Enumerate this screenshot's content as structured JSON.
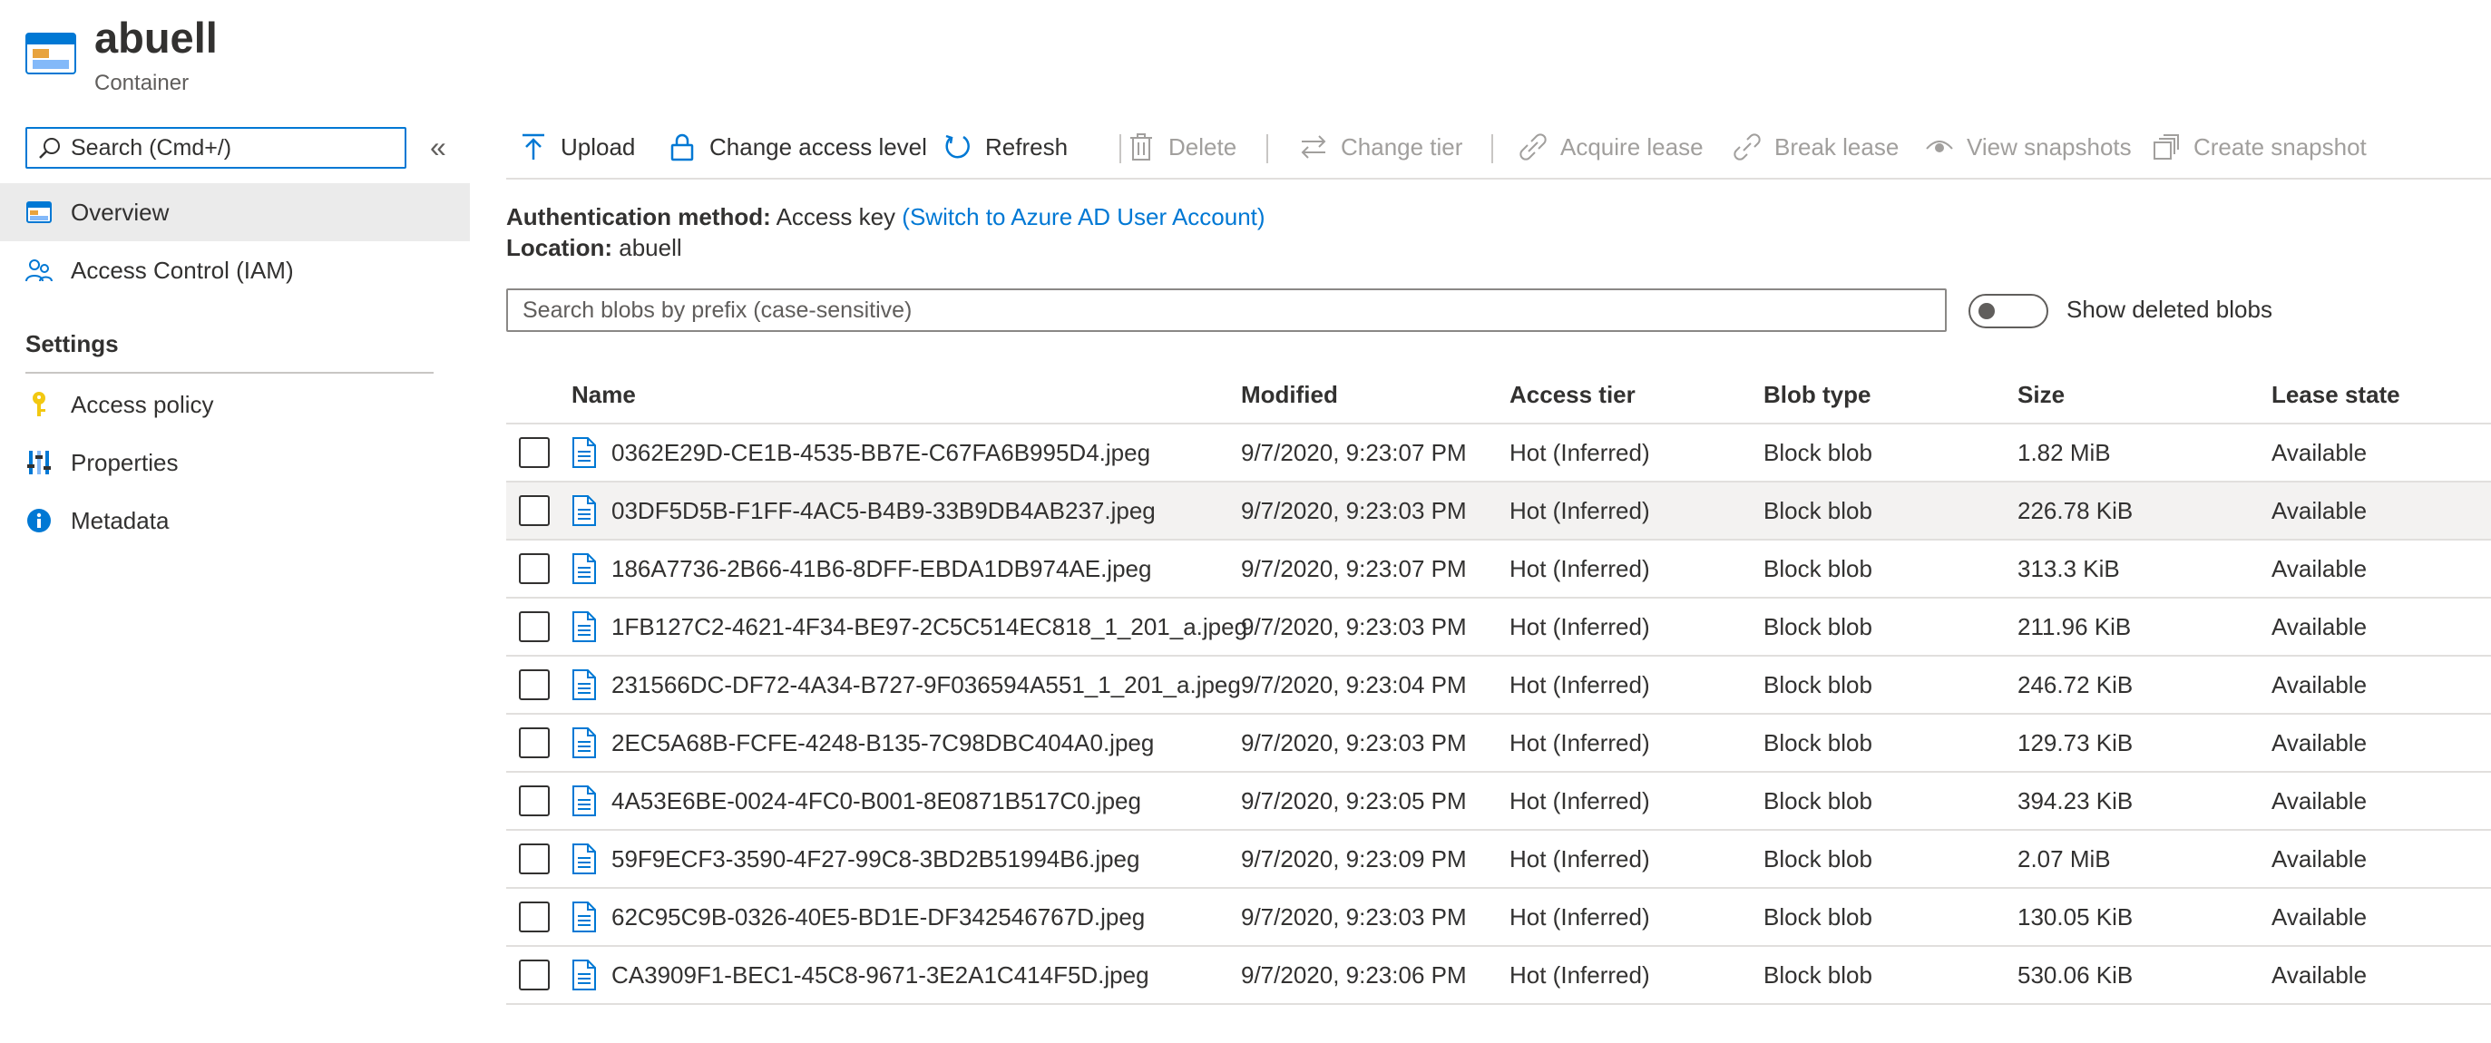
{
  "header": {
    "title": "abuell",
    "subtitle": "Container"
  },
  "sidebar": {
    "search_placeholder": "Search (Cmd+/)",
    "collapse_glyph": "«",
    "items": [
      {
        "label": "Overview",
        "icon": "container-icon",
        "active": true
      },
      {
        "label": "Access Control (IAM)",
        "icon": "people-icon",
        "active": false
      }
    ],
    "settings_title": "Settings",
    "settings_items": [
      {
        "label": "Access policy",
        "icon": "key-icon"
      },
      {
        "label": "Properties",
        "icon": "sliders-icon"
      },
      {
        "label": "Metadata",
        "icon": "info-icon"
      }
    ]
  },
  "toolbar": {
    "upload": "Upload",
    "change_access_level": "Change access level",
    "refresh": "Refresh",
    "delete": "Delete",
    "change_tier": "Change tier",
    "acquire_lease": "Acquire lease",
    "break_lease": "Break lease",
    "view_snapshots": "View snapshots",
    "create_snapshot": "Create snapshot"
  },
  "info": {
    "auth_label": "Authentication method:",
    "auth_value": "Access key",
    "auth_link": "(Switch to Azure AD User Account)",
    "location_label": "Location:",
    "location_value": "abuell"
  },
  "blob_search": {
    "placeholder": "Search blobs by prefix (case-sensitive)"
  },
  "show_deleted": {
    "label": "Show deleted blobs",
    "on": false
  },
  "table": {
    "columns": [
      "Name",
      "Modified",
      "Access tier",
      "Blob type",
      "Size",
      "Lease state"
    ],
    "rows": [
      {
        "name": "0362E29D-CE1B-4535-BB7E-C67FA6B995D4.jpeg",
        "modified": "9/7/2020, 9:23:07 PM",
        "tier": "Hot (Inferred)",
        "type": "Block blob",
        "size": "1.82 MiB",
        "lease": "Available"
      },
      {
        "name": "03DF5D5B-F1FF-4AC5-B4B9-33B9DB4AB237.jpeg",
        "modified": "9/7/2020, 9:23:03 PM",
        "tier": "Hot (Inferred)",
        "type": "Block blob",
        "size": "226.78 KiB",
        "lease": "Available"
      },
      {
        "name": "186A7736-2B66-41B6-8DFF-EBDA1DB974AE.jpeg",
        "modified": "9/7/2020, 9:23:07 PM",
        "tier": "Hot (Inferred)",
        "type": "Block blob",
        "size": "313.3 KiB",
        "lease": "Available"
      },
      {
        "name": "1FB127C2-4621-4F34-BE97-2C5C514EC818_1_201_a.jpeg",
        "modified": "9/7/2020, 9:23:03 PM",
        "tier": "Hot (Inferred)",
        "type": "Block blob",
        "size": "211.96 KiB",
        "lease": "Available"
      },
      {
        "name": "231566DC-DF72-4A34-B727-9F036594A551_1_201_a.jpeg",
        "modified": "9/7/2020, 9:23:04 PM",
        "tier": "Hot (Inferred)",
        "type": "Block blob",
        "size": "246.72 KiB",
        "lease": "Available"
      },
      {
        "name": "2EC5A68B-FCFE-4248-B135-7C98DBC404A0.jpeg",
        "modified": "9/7/2020, 9:23:03 PM",
        "tier": "Hot (Inferred)",
        "type": "Block blob",
        "size": "129.73 KiB",
        "lease": "Available"
      },
      {
        "name": "4A53E6BE-0024-4FC0-B001-8E0871B517C0.jpeg",
        "modified": "9/7/2020, 9:23:05 PM",
        "tier": "Hot (Inferred)",
        "type": "Block blob",
        "size": "394.23 KiB",
        "lease": "Available"
      },
      {
        "name": "59F9ECF3-3590-4F27-99C8-3BD2B51994B6.jpeg",
        "modified": "9/7/2020, 9:23:09 PM",
        "tier": "Hot (Inferred)",
        "type": "Block blob",
        "size": "2.07 MiB",
        "lease": "Available"
      },
      {
        "name": "62C95C9B-0326-40E5-BD1E-DF342546767D.jpeg",
        "modified": "9/7/2020, 9:23:03 PM",
        "tier": "Hot (Inferred)",
        "type": "Block blob",
        "size": "130.05 KiB",
        "lease": "Available"
      },
      {
        "name": "CA3909F1-BEC1-45C8-9671-3E2A1C414F5D.jpeg",
        "modified": "9/7/2020, 9:23:06 PM",
        "tier": "Hot (Inferred)",
        "type": "Block blob",
        "size": "530.06 KiB",
        "lease": "Available"
      }
    ]
  },
  "colors": {
    "accent": "#0078d4",
    "disabled": "#a19f9d",
    "key": "#f2c811"
  }
}
